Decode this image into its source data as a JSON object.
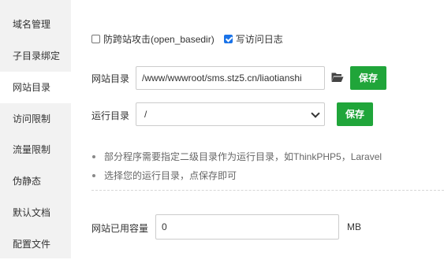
{
  "sidebar": {
    "items": [
      {
        "label": "域名管理"
      },
      {
        "label": "子目录绑定"
      },
      {
        "label": "网站目录",
        "active": true
      },
      {
        "label": "访问限制"
      },
      {
        "label": "流量限制"
      },
      {
        "label": "伪静态"
      },
      {
        "label": "默认文档"
      },
      {
        "label": "配置文件"
      }
    ]
  },
  "options": {
    "anti_cross_site": {
      "label": "防跨站攻击(open_basedir)",
      "checked": false
    },
    "access_log": {
      "label": "写访问日志",
      "checked": true
    }
  },
  "site_dir": {
    "label": "网站目录",
    "value": "/www/wwwroot/sms.stz5.cn/liaotianshi",
    "save_label": "保存",
    "icon": "folder-open-icon"
  },
  "run_dir": {
    "label": "运行目录",
    "selected": "/",
    "save_label": "保存"
  },
  "tips": [
    "部分程序需要指定二级目录作为运行目录，如ThinkPHP5，Laravel",
    "选择您的运行目录，点保存即可"
  ],
  "capacity": {
    "label": "网站已用容量",
    "value": "0",
    "unit": "MB"
  },
  "colors": {
    "save_button": "#20a53a",
    "sidebar_bg": "#f2f2f2",
    "checkbox_checked": "#1a73e8"
  }
}
